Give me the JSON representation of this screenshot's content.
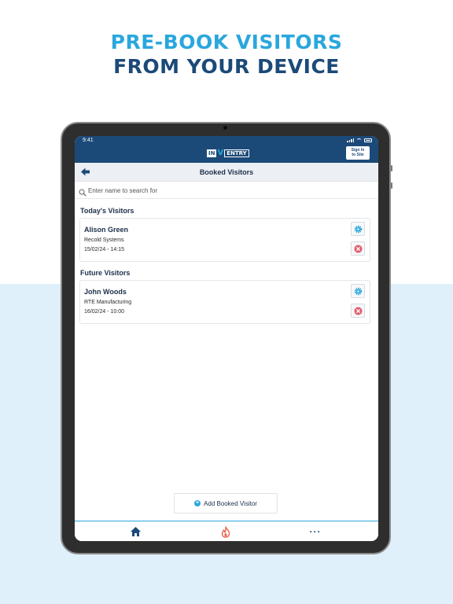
{
  "headline": {
    "line1": "PRE-BOOK VISITORS",
    "line2": "FROM YOUR DEVICE"
  },
  "status_bar": {
    "time": "9:41"
  },
  "app_header": {
    "logo_part1": "IN",
    "logo_part2": "V",
    "logo_part3": "ENTRY",
    "sign_in_button": "Sign In\nto Site"
  },
  "nav": {
    "title": "Booked Visitors",
    "back_icon": "arrow-left-icon"
  },
  "search": {
    "placeholder": "Enter name to search for",
    "value": ""
  },
  "sections": {
    "today": {
      "title": "Today's Visitors",
      "visitors": [
        {
          "name": "Alison Green",
          "company": "Recold Systems",
          "datetime": "15/02/24 - 14:15"
        }
      ]
    },
    "future": {
      "title": "Future Visitors",
      "visitors": [
        {
          "name": "John Woods",
          "company": "RTE Manufacturing",
          "datetime": "16/02/24 - 10:00"
        }
      ]
    }
  },
  "add_button": {
    "label": "Add Booked Visitor"
  },
  "tabbar": {
    "items": [
      "home-icon",
      "fire-icon",
      "more-icon"
    ]
  },
  "colors": {
    "brand_navy": "#1c4a78",
    "brand_blue": "#2aa7dd",
    "delete_red": "#e0606b",
    "bg_light_blue": "#dff0fa"
  }
}
